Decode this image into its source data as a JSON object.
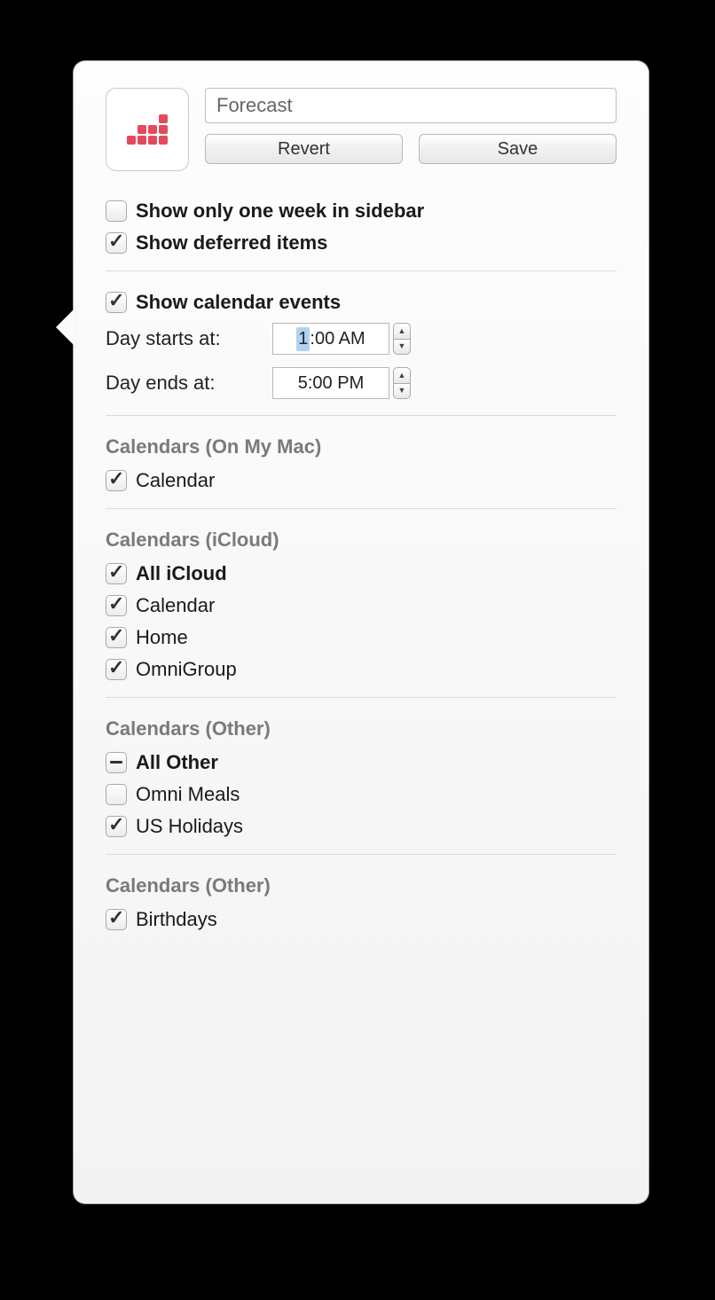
{
  "header": {
    "name_value": "Forecast",
    "revert_label": "Revert",
    "save_label": "Save"
  },
  "options": {
    "only_one_week": {
      "label": "Show only one week in sidebar",
      "checked": false
    },
    "show_deferred": {
      "label": "Show deferred items",
      "checked": true
    },
    "show_calendar_events": {
      "label": "Show calendar events",
      "checked": true
    }
  },
  "day_start": {
    "label": "Day starts at:",
    "value": "1:00 AM",
    "selected_part": "1"
  },
  "day_end": {
    "label": "Day ends at:",
    "value": "5:00 PM"
  },
  "sections": [
    {
      "title": "Calendars (On My Mac)",
      "items": [
        {
          "label": "Calendar",
          "state": "checked",
          "bold": false
        }
      ]
    },
    {
      "title": "Calendars (iCloud)",
      "items": [
        {
          "label": "All iCloud",
          "state": "checked",
          "bold": true
        },
        {
          "label": "Calendar",
          "state": "checked",
          "bold": false
        },
        {
          "label": "Home",
          "state": "checked",
          "bold": false
        },
        {
          "label": "OmniGroup",
          "state": "checked",
          "bold": false
        }
      ]
    },
    {
      "title": "Calendars (Other)",
      "items": [
        {
          "label": "All Other",
          "state": "mixed",
          "bold": true
        },
        {
          "label": "Omni Meals",
          "state": "unchecked",
          "bold": false
        },
        {
          "label": "US Holidays",
          "state": "checked",
          "bold": false
        }
      ]
    },
    {
      "title": "Calendars (Other)",
      "items": [
        {
          "label": "Birthdays",
          "state": "checked",
          "bold": false
        }
      ]
    }
  ]
}
